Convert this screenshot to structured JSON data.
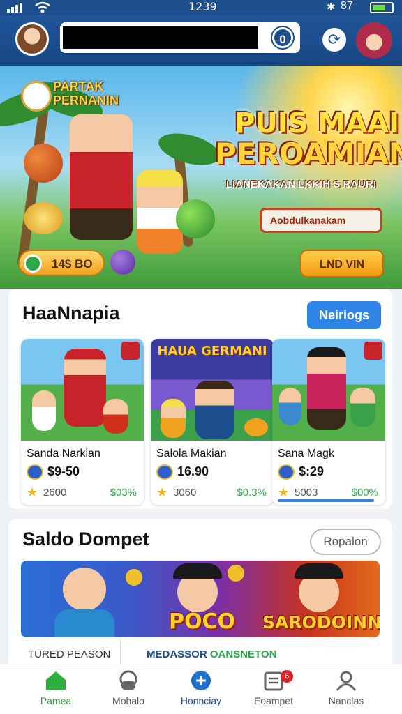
{
  "status_bar": {
    "time": "1239",
    "battery": "87",
    "bluetooth": "✱"
  },
  "header": {
    "notification_count": "0"
  },
  "hero": {
    "stamp_text": "PARTAK PERNANIN",
    "title_line1": "PUIS MAAI",
    "title_line2": "PEROAMIAN",
    "subtitle": "LIANEKAKAN LKKIH S RAURI",
    "promo_label": "Aobdulkanakam",
    "coins_label": "14$ BO",
    "cta_label": "LND VIN"
  },
  "games_section": {
    "title": "HaaNnapia",
    "button_label": "Neiriogs",
    "thumb_overlay_2": "HAUA GERMANI",
    "items": [
      {
        "name": "Sanda Narkian",
        "price": "$9-50",
        "count": "2600",
        "percent": "$03%"
      },
      {
        "name": "Salola Makian",
        "price": "16.90",
        "count": "3060",
        "percent": "$0.3%"
      },
      {
        "name": "Sana Magk",
        "price": "$:29",
        "count": "5003",
        "percent": "$00%"
      }
    ]
  },
  "wallet_section": {
    "title": "Saldo Dompet",
    "button_label": "Ropalon",
    "banner_text_1": "POCO",
    "banner_text_2": "SARODOINNH",
    "label_left": "TURED PEASON",
    "label_right_1": "MEDASSOR",
    "label_right_2": "OANSNETON"
  },
  "nav": {
    "items": [
      {
        "label": "Pamea",
        "icon": "home-icon"
      },
      {
        "label": "Mohalo",
        "icon": "game-controller-icon"
      },
      {
        "label": "Honnciay",
        "icon": "plus-circle-icon"
      },
      {
        "label": "Eoampet",
        "icon": "wallet-icon"
      },
      {
        "label": "Nanclas",
        "icon": "profile-icon"
      }
    ],
    "wallet_badge": "6"
  },
  "colors": {
    "header_blue": "#1d4f8f",
    "active_green": "#2a9a3a",
    "primary_blue": "#2f86e8",
    "accent_gold": "#ffd22a"
  }
}
